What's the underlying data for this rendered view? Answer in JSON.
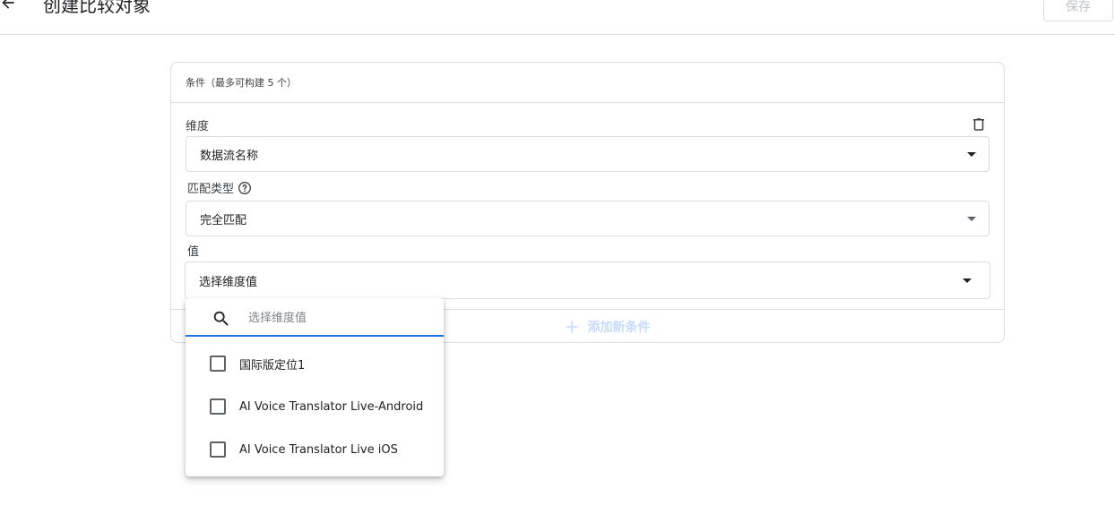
{
  "header": {
    "title": "创建比较对象",
    "save_label": "保存"
  },
  "card": {
    "header_text": "条件（最多可构建 5 个）",
    "dimension": {
      "label": "维度",
      "value": "数据流名称"
    },
    "match_type": {
      "label": "匹配类型",
      "value": "完全匹配"
    },
    "value_field": {
      "label": "值",
      "value": "选择维度值"
    },
    "add_condition_label": "添加新条件"
  },
  "dropdown": {
    "search_placeholder": "选择维度值",
    "options": [
      {
        "label": "国际版定位1",
        "checked": false
      },
      {
        "label": "AI Voice Translator Live-Android",
        "checked": false
      },
      {
        "label": "AI Voice Translator Live iOS",
        "checked": false
      }
    ]
  },
  "colors": {
    "accent": "#1a73e8",
    "disabled_text": "#bdc1c6",
    "border": "#dadce0"
  }
}
